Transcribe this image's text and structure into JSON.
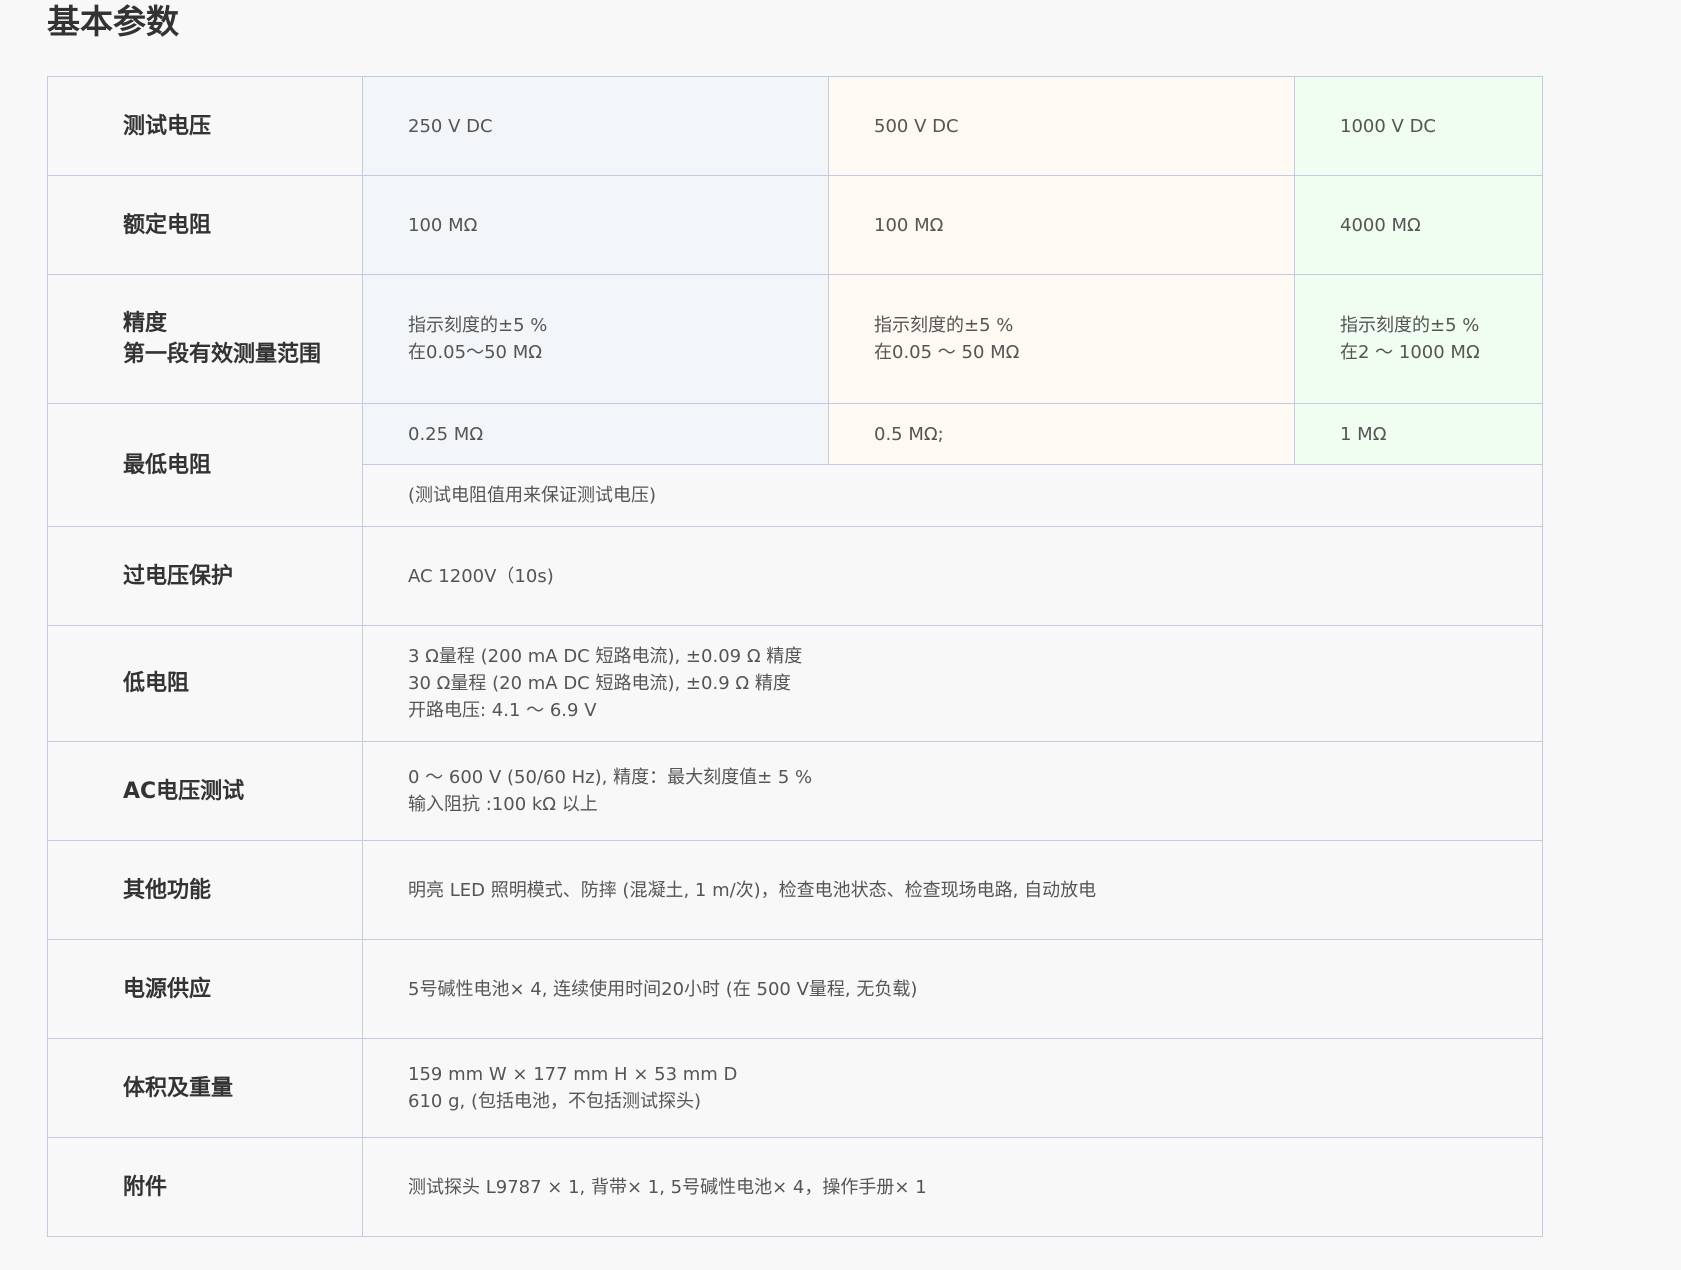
{
  "title": "基本参数",
  "rows": {
    "test_voltage": {
      "label": "测试电压",
      "v1": "250 V DC",
      "v2": "500 V DC",
      "v3": "1000 V DC"
    },
    "rated_resistance": {
      "label": "额定电阻",
      "v1": "100 MΩ",
      "v2": "100 MΩ",
      "v3": "4000 MΩ"
    },
    "accuracy": {
      "label_line1": "精度",
      "label_line2": "第一段有效测量范围",
      "v1": [
        "指示刻度的±5 %",
        "在0.05～50 MΩ"
      ],
      "v2": [
        "指示刻度的±5 %",
        "在0.05 ～ 50 MΩ"
      ],
      "v3": [
        "指示刻度的±5 %",
        "在2 ～ 1000 MΩ"
      ]
    },
    "min_resistance": {
      "label": "最低电阻",
      "v1": "0.25 MΩ",
      "v2": "0.5 MΩ;",
      "v3": "1 MΩ",
      "note": "(测试电阻值用来保证测试电压)"
    },
    "overvoltage": {
      "label": "过电压保护",
      "value": "AC 1200V（10s)"
    },
    "low_resistance": {
      "label": "低电阻",
      "lines": [
        "3 Ω量程 (200 mA DC 短路电流), ±0.09 Ω 精度",
        "30 Ω量程 (20 mA DC 短路电流), ±0.9 Ω 精度",
        "开路电压: 4.1 ～ 6.9 V"
      ]
    },
    "ac_voltage": {
      "label": "AC电压测试",
      "lines": [
        "0 ～ 600 V (50/60 Hz), 精度：最大刻度值± 5 %",
        "输入阻抗 :100 kΩ 以上"
      ]
    },
    "other_functions": {
      "label": "其他功能",
      "value": "明亮 LED 照明模式、防摔 (混凝土, 1 m/次)，检查电池状态、检查现场电路, 自动放电"
    },
    "power_supply": {
      "label": "电源供应",
      "value": "5号碱性电池× 4, 连续使用时间20小时 (在 500 V量程, 无负载)"
    },
    "size_weight": {
      "label": "体积及重量",
      "lines": [
        "159 mm W × 177 mm H × 53 mm D",
        "610 g, (包括电池，不包括测试探头)"
      ]
    },
    "accessories": {
      "label": "附件",
      "value": "测试探头 L9787 × 1, 背带× 1, 5号碱性电池× 4，操作手册× 1"
    }
  },
  "colors": {
    "col1_bg": "#f2f6f9",
    "col2_bg": "#fef9f2",
    "col3_bg": "#f0fdf1",
    "border": "#c3cbe0"
  }
}
